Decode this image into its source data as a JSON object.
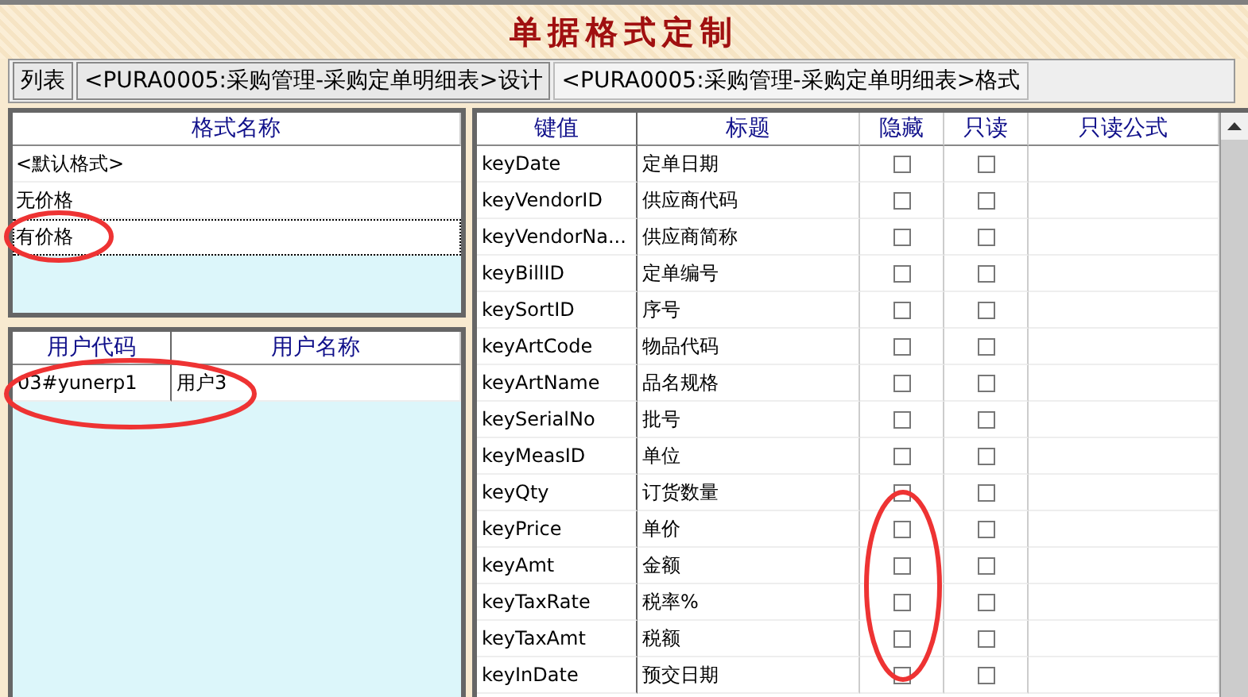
{
  "window": {
    "title": "单据格式定制"
  },
  "tabs": [
    {
      "label": "列表",
      "selected": false
    },
    {
      "label": "<PURA0005:采购管理-采购定单明细表>设计",
      "selected": false
    },
    {
      "label": "<PURA0005:采购管理-采购定单明细表>格式",
      "selected": true
    }
  ],
  "formats": {
    "column": "格式名称",
    "items": [
      {
        "name": "<默认格式>",
        "selected": false,
        "circled": false
      },
      {
        "name": "无价格",
        "selected": false,
        "circled": false
      },
      {
        "name": "有价格",
        "selected": true,
        "circled": true
      }
    ]
  },
  "users": {
    "columns": [
      "用户代码",
      "用户名称"
    ],
    "rows": [
      {
        "cells": [
          "03#yunerp1",
          "用户3"
        ],
        "circled": true
      }
    ]
  },
  "fields": {
    "columns": [
      "键值",
      "标题",
      "隐藏",
      "只读",
      "只读公式"
    ],
    "rows": [
      {
        "key": "keyDate",
        "title": "定单日期",
        "hidden": false,
        "readonly": false,
        "circled": false
      },
      {
        "key": "keyVendorID",
        "title": "供应商代码",
        "hidden": false,
        "readonly": false,
        "circled": false
      },
      {
        "key": "keyVendorNa...",
        "title": "供应商简称",
        "hidden": false,
        "readonly": false,
        "circled": false
      },
      {
        "key": "keyBillID",
        "title": "定单编号",
        "hidden": false,
        "readonly": false,
        "circled": false
      },
      {
        "key": "keySortID",
        "title": "序号",
        "hidden": false,
        "readonly": false,
        "circled": false
      },
      {
        "key": "keyArtCode",
        "title": "物品代码",
        "hidden": false,
        "readonly": false,
        "circled": false
      },
      {
        "key": "keyArtName",
        "title": "品名规格",
        "hidden": false,
        "readonly": false,
        "circled": false
      },
      {
        "key": "keySerialNo",
        "title": "批号",
        "hidden": false,
        "readonly": false,
        "circled": false
      },
      {
        "key": "keyMeasID",
        "title": "单位",
        "hidden": false,
        "readonly": false,
        "circled": false
      },
      {
        "key": "keyQty",
        "title": "订货数量",
        "hidden": false,
        "readonly": false,
        "circled": false
      },
      {
        "key": "keyPrice",
        "title": "单价",
        "hidden": false,
        "readonly": false,
        "circled": true
      },
      {
        "key": "keyAmt",
        "title": "金额",
        "hidden": false,
        "readonly": false,
        "circled": true
      },
      {
        "key": "keyTaxRate",
        "title": "税率%",
        "hidden": false,
        "readonly": false,
        "circled": true
      },
      {
        "key": "keyTaxAmt",
        "title": "税额",
        "hidden": false,
        "readonly": false,
        "circled": true
      },
      {
        "key": "keyInDate",
        "title": "预交日期",
        "hidden": false,
        "readonly": false,
        "circled": false
      }
    ]
  }
}
